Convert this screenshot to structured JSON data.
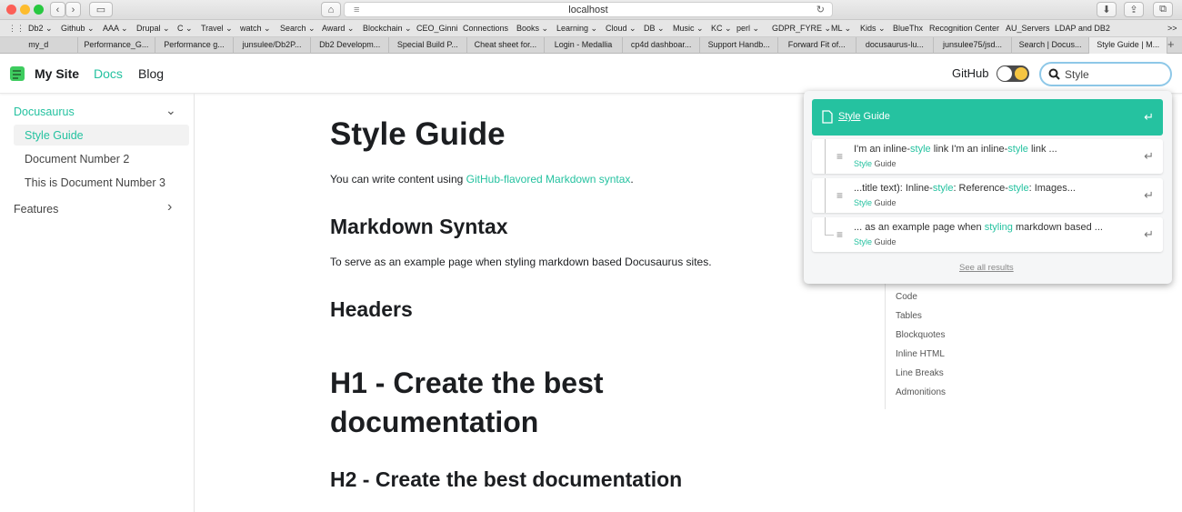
{
  "browser": {
    "url": "localhost",
    "bookmarks": [
      "Db2 ⌄",
      "Github ⌄",
      "AAA ⌄",
      "Drupal ⌄",
      "C ⌄",
      "Travel ⌄",
      "watch ⌄",
      "Search ⌄",
      "Award ⌄",
      "Blockchain ⌄",
      "CEO_Ginni",
      "Connections",
      "Books ⌄",
      "Learning ⌄",
      "Cloud ⌄",
      "DB ⌄",
      "Music ⌄",
      "KC ⌄",
      "perl ⌄",
      "GDPR_FYRE ⌄",
      "ML ⌄",
      "Kids ⌄",
      "BlueThx",
      "Recognition Center",
      "AU_Servers",
      "LDAP and DB2"
    ],
    "tabs": [
      "my_d",
      "Performance_G...",
      "Performance g...",
      "junsulee/Db2P...",
      "Db2 Developm...",
      "Special Build P...",
      "Cheat sheet for...",
      "Login - Medallia",
      "cp4d dashboar...",
      "Support Handb...",
      "Forward Fit of...",
      "docusaurus-lu...",
      "junsulee75/jsd...",
      "Search | Docus...",
      "Style Guide | M..."
    ]
  },
  "navbar": {
    "brand": "My Site",
    "links": [
      "Docs",
      "Blog"
    ],
    "github": "GitHub",
    "search_value": "Style"
  },
  "sidebar": {
    "category": "Docusaurus",
    "items": [
      "Style Guide",
      "Document Number 2",
      "This is Document Number 3"
    ],
    "features": "Features"
  },
  "main": {
    "title": "Style Guide",
    "intro_prefix": "You can write content using ",
    "intro_link": "GitHub-flavored Markdown syntax",
    "intro_suffix": ".",
    "h_markdown": "Markdown Syntax",
    "markdown_text": "To serve as an example page when styling markdown based Docusaurus sites.",
    "h_headers": "Headers",
    "h1_line1": "H1 - Create the best",
    "h1_line2": "documentation",
    "h2": "H2 - Create the best documentation"
  },
  "toc": [
    "Code",
    "Tables",
    "Blockquotes",
    "Inline HTML",
    "Line Breaks",
    "Admonitions"
  ],
  "search_results": {
    "top": {
      "match": "Style",
      "rest": " Guide"
    },
    "hits": [
      {
        "pre1": "I'm an inline-",
        "m1": "style",
        "mid": " link I'm an inline-",
        "m2": "style",
        "post": " link ...",
        "crumb_m": "Style",
        "crumb_r": " Guide"
      },
      {
        "pre1": "...title text): Inline-",
        "m1": "style",
        "mid": ": Reference-",
        "m2": "style",
        "post": ": Images...",
        "crumb_m": "Style",
        "crumb_r": " Guide"
      },
      {
        "pre1": "... as an example page when ",
        "m1": "styling",
        "mid": " markdown based ...",
        "m2": "",
        "post": "",
        "crumb_m": "Style",
        "crumb_r": " Guide"
      }
    ],
    "see_all": "See all results"
  },
  "colors": {
    "accent": "#25c2a0",
    "link": "#25c2a0"
  }
}
